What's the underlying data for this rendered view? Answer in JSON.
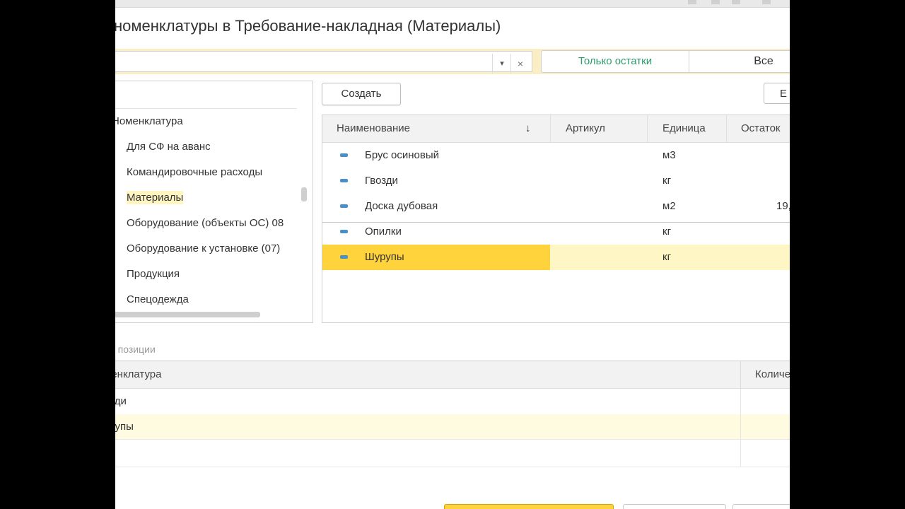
{
  "window": {
    "title": "номенклатуры в Требование-накладная (Материалы)"
  },
  "search": {
    "value": "",
    "dropdown_icon": "▾",
    "clear_icon": "×"
  },
  "filters": {
    "only_remaining": "Только остатки",
    "all": "Все"
  },
  "tree": {
    "root": "Номенклатура",
    "items": [
      {
        "label": "Для СФ на аванс"
      },
      {
        "label": "Командировочные расходы"
      },
      {
        "label": "Материалы",
        "selected": true
      },
      {
        "label": "Оборудование (объекты ОС) 08"
      },
      {
        "label": "Оборудование к установке (07)"
      },
      {
        "label": "Продукция"
      },
      {
        "label": "Спецодежда"
      }
    ]
  },
  "toolbar": {
    "create_label": "Создать",
    "more_label": "Е"
  },
  "items_table": {
    "columns": {
      "name": "Наименование",
      "sort_icon": "↓",
      "article": "Артикул",
      "unit": "Единица",
      "remaining": "Остаток"
    },
    "rows": [
      {
        "name": "Брус осиновый",
        "article": "",
        "unit": "м3",
        "remaining": "("
      },
      {
        "name": "Гвозди",
        "article": "",
        "unit": "кг",
        "remaining": ""
      },
      {
        "name": "Доска дубовая",
        "article": "",
        "unit": "м2",
        "remaining": "19,"
      },
      {
        "name": "Опилки",
        "article": "",
        "unit": "кг",
        "remaining": ""
      },
      {
        "name": "Шурупы",
        "article": "",
        "unit": "кг",
        "remaining": ""
      }
    ],
    "selected_row": "Шурупы"
  },
  "selected_positions": {
    "label": "е позиции",
    "columns": {
      "name": "менклатура",
      "quantity": "Количе"
    },
    "rows": [
      {
        "name": "озди"
      },
      {
        "name": "урупы"
      }
    ]
  },
  "colors": {
    "accent_yellow": "#ffd33b",
    "light_yellow": "#fff6c6",
    "search_bar_bg": "#fbedc4",
    "filter_green": "#2e9b6b",
    "item_icon_blue": "#4a8fc8"
  }
}
